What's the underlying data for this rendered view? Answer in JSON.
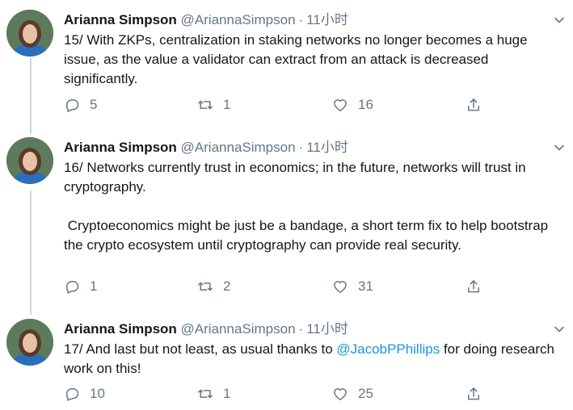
{
  "author": {
    "name": "Arianna Simpson",
    "handle": "@AriannaSimpson",
    "separator": "·",
    "time": "11小时"
  },
  "tweets": [
    {
      "paragraphs": [
        "15/ With ZKPs, centralization in staking networks no longer becomes a huge issue, as the value a validator can extract from an attack is decreased significantly."
      ],
      "replies": "5",
      "retweets": "1",
      "likes": "16"
    },
    {
      "paragraphs": [
        "16/ Networks currently trust in economics; in the future, networks will trust in cryptography.",
        " Cryptoeconomics might be just be a bandage, a short term fix to help bootstrap the crypto ecosystem until cryptography can provide real security."
      ],
      "replies": "1",
      "retweets": "2",
      "likes": "31"
    },
    {
      "text_before": "17/ And last but not least, as usual thanks to ",
      "mention": "@JacobPPhillips",
      "text_after": " for doing research work on this!",
      "replies": "10",
      "retweets": "1",
      "likes": "25"
    }
  ],
  "icons": {
    "reply": "reply-icon",
    "retweet": "retweet-icon",
    "like": "heart-icon",
    "share": "share-icon",
    "caret": "chevron-down-icon"
  },
  "colors": {
    "text": "#14171a",
    "secondary": "#657786",
    "link": "#1b95e0",
    "thread_line": "#ccd6dd"
  }
}
